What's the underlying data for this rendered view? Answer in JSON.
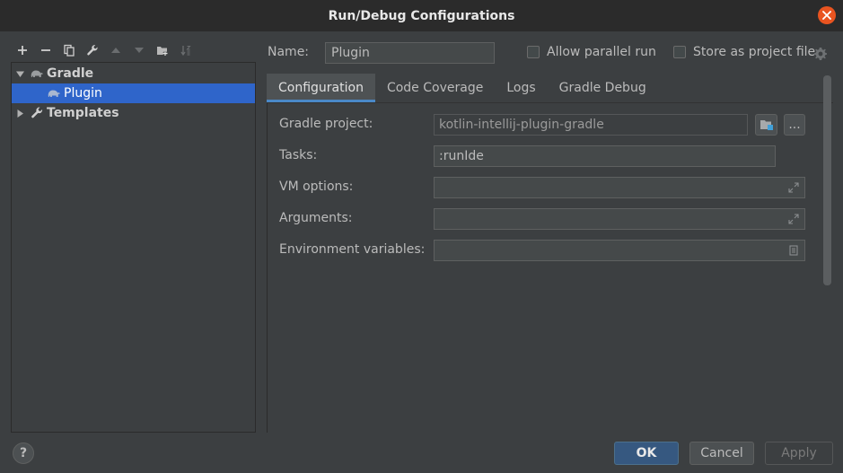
{
  "window": {
    "title": "Run/Debug Configurations"
  },
  "toolbar": {
    "buttons": [
      "add-icon",
      "remove-icon",
      "copy-icon",
      "wrench-icon",
      "move-up-icon",
      "move-down-icon",
      "new-folder-icon",
      "sort-icon"
    ]
  },
  "tree": {
    "items": [
      {
        "label": "Gradle",
        "expanded": true,
        "icon": "gradle-elephant-icon"
      },
      {
        "label": "Plugin",
        "selected": true,
        "icon": "gradle-elephant-icon"
      },
      {
        "label": "Templates",
        "expanded": false,
        "icon": "wrench-icon"
      }
    ]
  },
  "config": {
    "name_label": "Name:",
    "name_value": "Plugin",
    "allow_parallel_label": "Allow parallel run",
    "allow_parallel_checked": false,
    "store_as_project_label": "Store as project file",
    "store_as_project_checked": false
  },
  "tabs": [
    {
      "label": "Configuration",
      "active": true
    },
    {
      "label": "Code Coverage",
      "active": false
    },
    {
      "label": "Logs",
      "active": false
    },
    {
      "label": "Gradle Debug",
      "active": false
    }
  ],
  "fields": {
    "gradle_project_label": "Gradle project:",
    "gradle_project_value": "kotlin-intellij-plugin-gradle",
    "tasks_label": "Tasks:",
    "tasks_value": ":runIde",
    "vm_options_label": "VM options:",
    "vm_options_value": "",
    "arguments_label": "Arguments:",
    "arguments_value": "",
    "env_vars_label": "Environment variables:",
    "env_vars_value": "",
    "browse_label": "..."
  },
  "footer": {
    "help_label": "?",
    "ok_label": "OK",
    "cancel_label": "Cancel",
    "apply_label": "Apply"
  },
  "colors": {
    "accent": "#2f65ca",
    "ok_button": "#365880",
    "close_button": "#e95420",
    "tab_underline": "#4a88c7"
  }
}
